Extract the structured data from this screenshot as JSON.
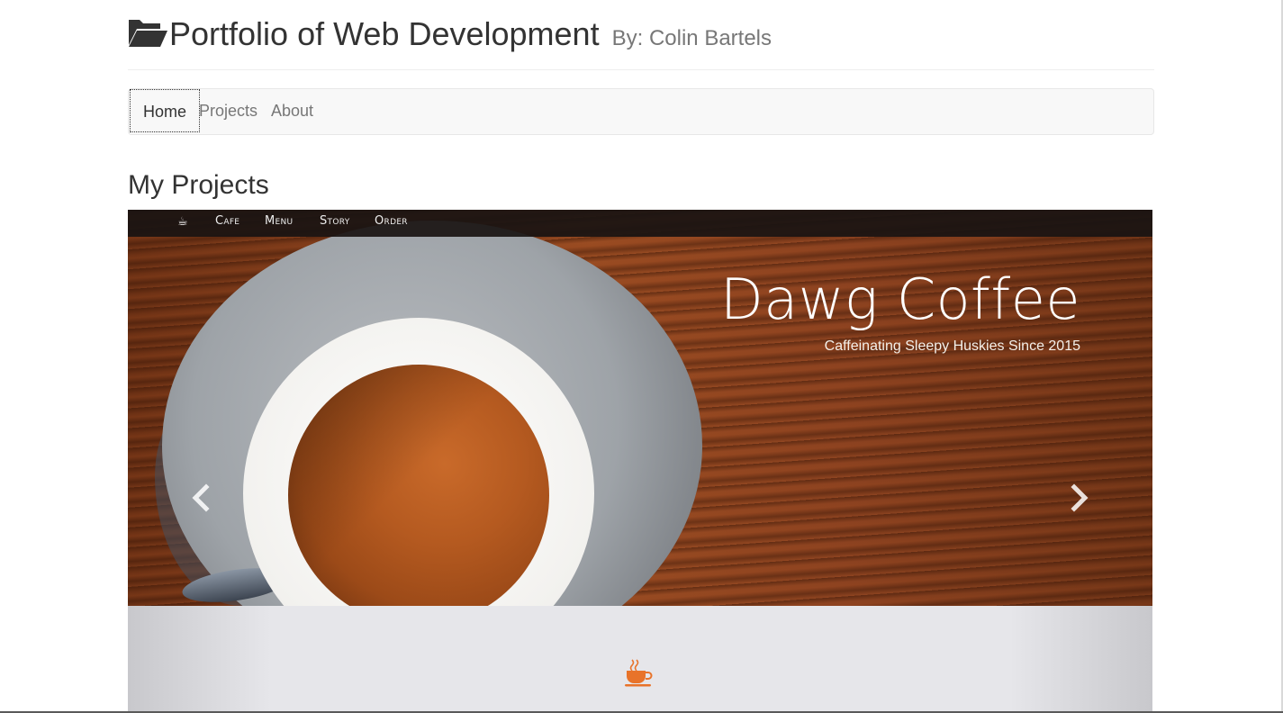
{
  "header": {
    "icon": "folder-open-icon",
    "title": "Portfolio of Web Development",
    "subtitle": "By: Colin Bartels"
  },
  "nav": {
    "items": [
      {
        "label": "Home",
        "active": true
      },
      {
        "label": "Projects",
        "active": false
      },
      {
        "label": "About",
        "active": false
      }
    ]
  },
  "section": {
    "title": "My Projects"
  },
  "carousel": {
    "slide": {
      "site_nav": {
        "icon": "coffee-cup-icon",
        "items": [
          "Cafe",
          "Menu",
          "Story",
          "Order"
        ]
      },
      "title": "Dawg Coffee",
      "subtitle": "Caffeinating Sleepy Huskies Since 2015",
      "footer_icon": "coffee-cup-icon"
    },
    "prev_icon": "chevron-left-icon",
    "next_icon": "chevron-right-icon"
  },
  "colors": {
    "accent_orange": "#e8732a",
    "nav_bg": "#f8f8f8",
    "text": "#333333",
    "muted": "#777777"
  }
}
